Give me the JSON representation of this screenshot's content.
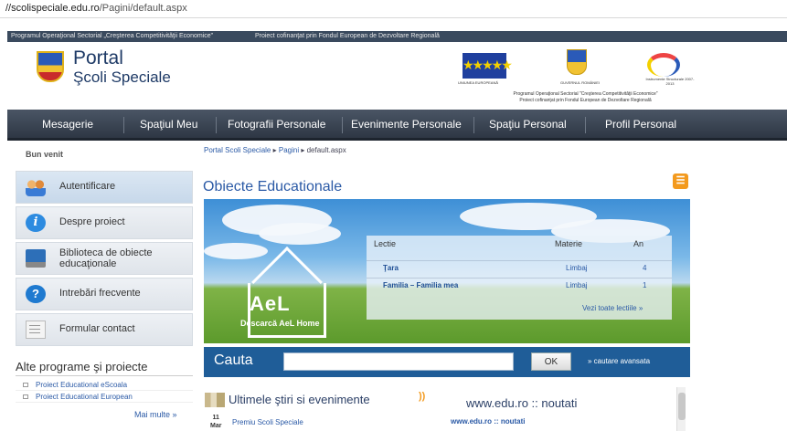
{
  "address": {
    "host": "//scolispeciale.edu.ro",
    "path": "/Pagini/default.aspx"
  },
  "top_strip": {
    "left": "Programul Operaţional Sectorial „Creşterea Competitivităţii Economice”",
    "right": "Proiect cofinanţat prin Fondul European de Dezvoltare Regională"
  },
  "logo": {
    "title": "Portal",
    "subtitle": "Şcoli Speciale"
  },
  "partners": {
    "eu_caption": "UNIUNEA EUROPEANĂ",
    "gov_caption": "GUVERNUL ROMÂNIEI",
    "is_caption": "Instrumente Structurale 2007-2013",
    "program_line1": "Programul Operaţional Sectorial \"Creşterea Competitivităţii Economice\"",
    "program_line2": "Proiect cofinanţat prin Fondul European de Dezvoltare Regională"
  },
  "nav": [
    "Mesagerie",
    "Spaţiul Meu",
    "Fotografii Personale",
    "Evenimente Personale",
    "Spaţiu Personal",
    "Profil Personal"
  ],
  "welcome": "Bun venit",
  "breadcrumb": {
    "root": "Portal Scoli Speciale",
    "section": "Pagini",
    "page": "default.aspx"
  },
  "sidebar": [
    {
      "label": "Autentificare",
      "icon": "users-icon"
    },
    {
      "label": "Despre proiect",
      "icon": "info-icon"
    },
    {
      "label": "Biblioteca de obiecte educaţionale",
      "icon": "laptop-icon"
    },
    {
      "label": "Intrebări frecvente",
      "icon": "help-icon"
    },
    {
      "label": "Formular contact",
      "icon": "form-icon"
    }
  ],
  "alte": {
    "title": "Alte programe şi proiecte",
    "items": [
      "Proiect Educational eScoala",
      "Proiect Educational European"
    ],
    "more": "Mai multe"
  },
  "objects": {
    "title": "Obiecte Educationale",
    "ael_logo": "AeL",
    "ael_caption": "Descarcă AeL Home",
    "headers": {
      "lesson": "Lectie",
      "subject": "Materie",
      "year": "An"
    },
    "rows": [
      {
        "lesson": "Ţara",
        "subject": "Limbaj",
        "year": "4"
      },
      {
        "lesson": "Familia – Familia mea",
        "subject": "Limbaj",
        "year": "1"
      }
    ],
    "all_lessons": "Vezi toate lectiile"
  },
  "search": {
    "label": "Cauta",
    "value": "",
    "ok": "OK",
    "advanced": "» cautare avansata"
  },
  "news": {
    "title": "Ultimele ştiri si evenimente",
    "day": "11",
    "month": "Mar",
    "item": "Premiu Scoli Speciale"
  },
  "edu": {
    "title": "www.edu.ro :: noutati",
    "link": "www.edu.ro :: noutati"
  },
  "colors": {
    "nav_bg": "#2e3744",
    "search_bg": "#1f5d98",
    "link": "#2b5aa6",
    "rss": "#f39a1e"
  }
}
